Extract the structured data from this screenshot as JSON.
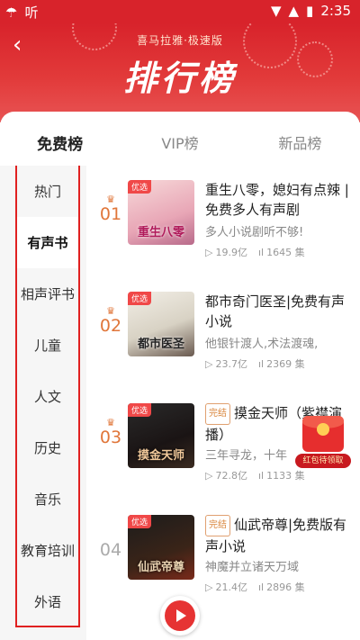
{
  "status_bar": {
    "left_text": "听",
    "time": "2:35"
  },
  "header": {
    "brand": "喜马拉雅·极速版",
    "title": "排行榜",
    "colors": {
      "primary": "#d8232b"
    }
  },
  "tabs": [
    {
      "label": "免费榜",
      "active": true
    },
    {
      "label": "VIP榜",
      "active": false
    },
    {
      "label": "新品榜",
      "active": false
    }
  ],
  "categories": [
    "热门",
    "有声书",
    "相声评书",
    "儿童",
    "人文",
    "历史",
    "音乐",
    "教育培训",
    "外语"
  ],
  "active_category": "有声书",
  "items": [
    {
      "rank": "01",
      "tag": "优选",
      "cover_text": "重生八零",
      "badge": "",
      "title": "重生八零，媳妇有点辣 | 免费多人有声剧",
      "desc": "多人小说剧听不够!",
      "plays": "19.9亿",
      "episodes": "1645 集"
    },
    {
      "rank": "02",
      "tag": "优选",
      "cover_text": "都市医圣",
      "badge": "",
      "title": "都市奇门医圣|免费有声小说",
      "desc": "他银针渡人,术法渡魂,",
      "plays": "23.7亿",
      "episodes": "2369 集"
    },
    {
      "rank": "03",
      "tag": "优选",
      "cover_text": "摸金天师",
      "badge": "完结",
      "title": "摸金天师（紫襟演播）",
      "desc": "三年寻龙，十年",
      "plays": "72.8亿",
      "episodes": "1133 集"
    },
    {
      "rank": "04",
      "tag": "优选",
      "cover_text": "仙武帝尊",
      "badge": "完结",
      "title": "仙武帝尊|免费版有声小说",
      "desc": "神魔并立诸天万域",
      "plays": "21.4亿",
      "episodes": "2896 集"
    }
  ],
  "red_packet": {
    "label": "红包待领取"
  },
  "icons": {
    "back": "back-arrow-icon",
    "play": "play-icon",
    "plays": "play-count-icon",
    "episodes": "episodes-icon"
  }
}
